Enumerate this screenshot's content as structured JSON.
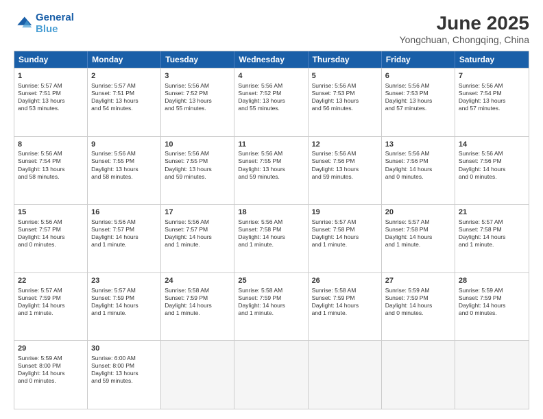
{
  "logo": {
    "line1": "General",
    "line2": "Blue"
  },
  "title": "June 2025",
  "subtitle": "Yongchuan, Chongqing, China",
  "header_days": [
    "Sunday",
    "Monday",
    "Tuesday",
    "Wednesday",
    "Thursday",
    "Friday",
    "Saturday"
  ],
  "weeks": [
    [
      {
        "day": "1",
        "lines": [
          "Sunrise: 5:57 AM",
          "Sunset: 7:51 PM",
          "Daylight: 13 hours",
          "and 53 minutes."
        ]
      },
      {
        "day": "2",
        "lines": [
          "Sunrise: 5:57 AM",
          "Sunset: 7:51 PM",
          "Daylight: 13 hours",
          "and 54 minutes."
        ]
      },
      {
        "day": "3",
        "lines": [
          "Sunrise: 5:56 AM",
          "Sunset: 7:52 PM",
          "Daylight: 13 hours",
          "and 55 minutes."
        ]
      },
      {
        "day": "4",
        "lines": [
          "Sunrise: 5:56 AM",
          "Sunset: 7:52 PM",
          "Daylight: 13 hours",
          "and 55 minutes."
        ]
      },
      {
        "day": "5",
        "lines": [
          "Sunrise: 5:56 AM",
          "Sunset: 7:53 PM",
          "Daylight: 13 hours",
          "and 56 minutes."
        ]
      },
      {
        "day": "6",
        "lines": [
          "Sunrise: 5:56 AM",
          "Sunset: 7:53 PM",
          "Daylight: 13 hours",
          "and 57 minutes."
        ]
      },
      {
        "day": "7",
        "lines": [
          "Sunrise: 5:56 AM",
          "Sunset: 7:54 PM",
          "Daylight: 13 hours",
          "and 57 minutes."
        ]
      }
    ],
    [
      {
        "day": "8",
        "lines": [
          "Sunrise: 5:56 AM",
          "Sunset: 7:54 PM",
          "Daylight: 13 hours",
          "and 58 minutes."
        ]
      },
      {
        "day": "9",
        "lines": [
          "Sunrise: 5:56 AM",
          "Sunset: 7:55 PM",
          "Daylight: 13 hours",
          "and 58 minutes."
        ]
      },
      {
        "day": "10",
        "lines": [
          "Sunrise: 5:56 AM",
          "Sunset: 7:55 PM",
          "Daylight: 13 hours",
          "and 59 minutes."
        ]
      },
      {
        "day": "11",
        "lines": [
          "Sunrise: 5:56 AM",
          "Sunset: 7:55 PM",
          "Daylight: 13 hours",
          "and 59 minutes."
        ]
      },
      {
        "day": "12",
        "lines": [
          "Sunrise: 5:56 AM",
          "Sunset: 7:56 PM",
          "Daylight: 13 hours",
          "and 59 minutes."
        ]
      },
      {
        "day": "13",
        "lines": [
          "Sunrise: 5:56 AM",
          "Sunset: 7:56 PM",
          "Daylight: 14 hours",
          "and 0 minutes."
        ]
      },
      {
        "day": "14",
        "lines": [
          "Sunrise: 5:56 AM",
          "Sunset: 7:56 PM",
          "Daylight: 14 hours",
          "and 0 minutes."
        ]
      }
    ],
    [
      {
        "day": "15",
        "lines": [
          "Sunrise: 5:56 AM",
          "Sunset: 7:57 PM",
          "Daylight: 14 hours",
          "and 0 minutes."
        ]
      },
      {
        "day": "16",
        "lines": [
          "Sunrise: 5:56 AM",
          "Sunset: 7:57 PM",
          "Daylight: 14 hours",
          "and 1 minute."
        ]
      },
      {
        "day": "17",
        "lines": [
          "Sunrise: 5:56 AM",
          "Sunset: 7:57 PM",
          "Daylight: 14 hours",
          "and 1 minute."
        ]
      },
      {
        "day": "18",
        "lines": [
          "Sunrise: 5:56 AM",
          "Sunset: 7:58 PM",
          "Daylight: 14 hours",
          "and 1 minute."
        ]
      },
      {
        "day": "19",
        "lines": [
          "Sunrise: 5:57 AM",
          "Sunset: 7:58 PM",
          "Daylight: 14 hours",
          "and 1 minute."
        ]
      },
      {
        "day": "20",
        "lines": [
          "Sunrise: 5:57 AM",
          "Sunset: 7:58 PM",
          "Daylight: 14 hours",
          "and 1 minute."
        ]
      },
      {
        "day": "21",
        "lines": [
          "Sunrise: 5:57 AM",
          "Sunset: 7:58 PM",
          "Daylight: 14 hours",
          "and 1 minute."
        ]
      }
    ],
    [
      {
        "day": "22",
        "lines": [
          "Sunrise: 5:57 AM",
          "Sunset: 7:59 PM",
          "Daylight: 14 hours",
          "and 1 minute."
        ]
      },
      {
        "day": "23",
        "lines": [
          "Sunrise: 5:57 AM",
          "Sunset: 7:59 PM",
          "Daylight: 14 hours",
          "and 1 minute."
        ]
      },
      {
        "day": "24",
        "lines": [
          "Sunrise: 5:58 AM",
          "Sunset: 7:59 PM",
          "Daylight: 14 hours",
          "and 1 minute."
        ]
      },
      {
        "day": "25",
        "lines": [
          "Sunrise: 5:58 AM",
          "Sunset: 7:59 PM",
          "Daylight: 14 hours",
          "and 1 minute."
        ]
      },
      {
        "day": "26",
        "lines": [
          "Sunrise: 5:58 AM",
          "Sunset: 7:59 PM",
          "Daylight: 14 hours",
          "and 1 minute."
        ]
      },
      {
        "day": "27",
        "lines": [
          "Sunrise: 5:59 AM",
          "Sunset: 7:59 PM",
          "Daylight: 14 hours",
          "and 0 minutes."
        ]
      },
      {
        "day": "28",
        "lines": [
          "Sunrise: 5:59 AM",
          "Sunset: 7:59 PM",
          "Daylight: 14 hours",
          "and 0 minutes."
        ]
      }
    ],
    [
      {
        "day": "29",
        "lines": [
          "Sunrise: 5:59 AM",
          "Sunset: 8:00 PM",
          "Daylight: 14 hours",
          "and 0 minutes."
        ]
      },
      {
        "day": "30",
        "lines": [
          "Sunrise: 6:00 AM",
          "Sunset: 8:00 PM",
          "Daylight: 13 hours",
          "and 59 minutes."
        ]
      },
      {
        "day": "",
        "lines": []
      },
      {
        "day": "",
        "lines": []
      },
      {
        "day": "",
        "lines": []
      },
      {
        "day": "",
        "lines": []
      },
      {
        "day": "",
        "lines": []
      }
    ]
  ]
}
